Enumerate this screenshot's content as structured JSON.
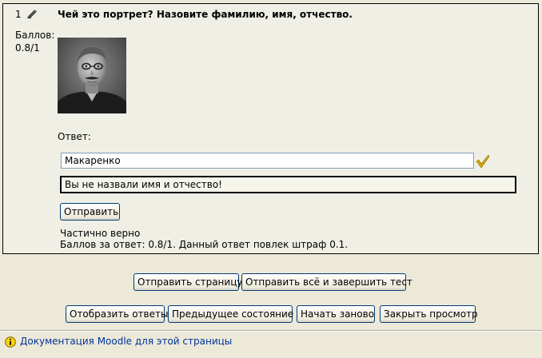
{
  "question": {
    "number": "1",
    "grade_label": "Баллов:",
    "grade_value": "0.8/1",
    "text": "Чей это портрет? Назовите фамилию, имя, отчество.",
    "answer_label": "Ответ:",
    "answer_value": "Макаренко",
    "feedback": "Вы не назвали имя и отчество!",
    "submit_label": "Отправить",
    "state": "Частично верно",
    "marks": "Баллов за ответ: 0.8/1. Данный ответ повлек штраф 0.1."
  },
  "actions": {
    "submit_page": "Отправить страницу",
    "submit_all": "Отправить всё и завершить тест",
    "show_answers": "Отобразить ответы",
    "previous_state": "Предыдущее состояние",
    "start_again": "Начать заново",
    "close_preview": "Закрыть просмотр"
  },
  "footer": {
    "doc_link": "Документация Moodle для этой страницы"
  },
  "icons": {
    "edit": "edit-icon",
    "check": "check-icon",
    "info": "info-icon"
  },
  "colors": {
    "page_bg": "#ece9d8",
    "link": "#003399",
    "check": "#d4a800"
  }
}
